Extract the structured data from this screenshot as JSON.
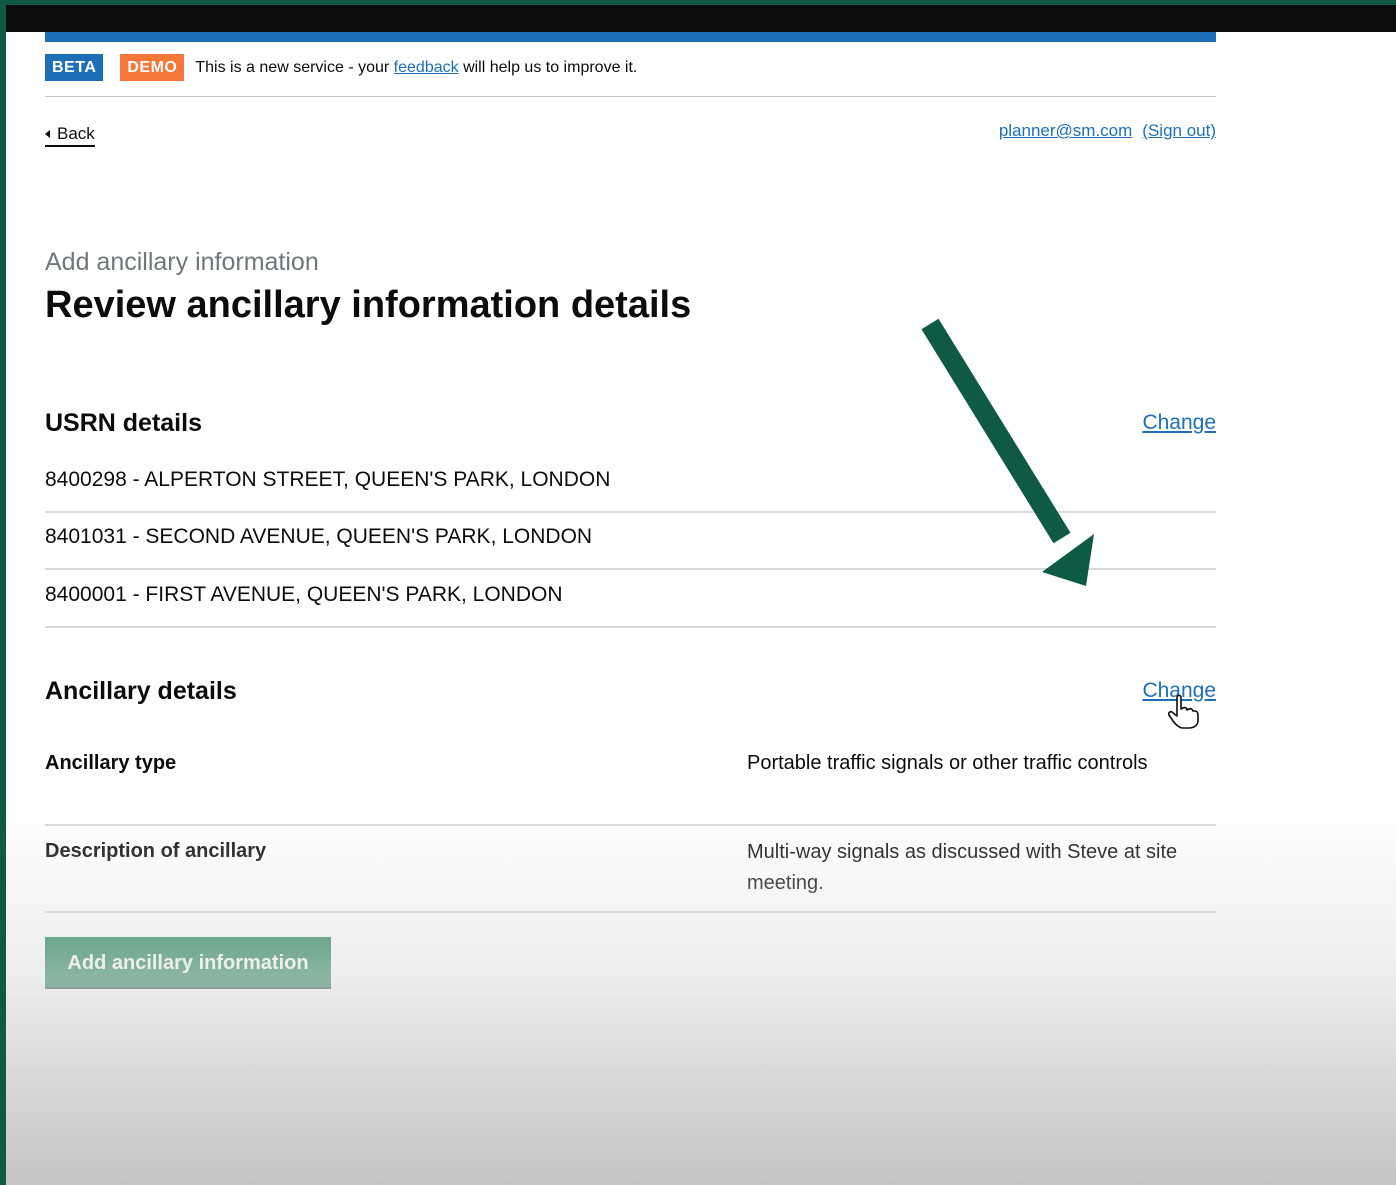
{
  "banner": {
    "beta_tag": "BETA",
    "demo_tag": "DEMO",
    "text_before": "This is a new service - your",
    "feedback_link": "feedback",
    "text_after": "will help us to improve it."
  },
  "nav": {
    "back_label": "Back",
    "user_email": "planner@sm.com",
    "sign_out": "(Sign out)"
  },
  "page": {
    "caption": "Add ancillary information",
    "title": "Review ancillary information details"
  },
  "usrn_section": {
    "heading": "USRN details",
    "change_label": "Change",
    "rows": [
      "8400298 - ALPERTON STREET, QUEEN'S PARK, LONDON",
      "8401031 - SECOND AVENUE, QUEEN'S PARK, LONDON",
      "8400001 - FIRST AVENUE, QUEEN'S PARK, LONDON"
    ]
  },
  "ancillary_section": {
    "heading": "Ancillary details",
    "change_label": "Change",
    "rows": [
      {
        "key": "Ancillary type",
        "value": "Portable traffic signals or other traffic controls"
      },
      {
        "key": "Description of ancillary",
        "value": "Multi-way signals as discussed with Steve at site meeting."
      }
    ]
  },
  "actions": {
    "submit_label": "Add ancillary information"
  },
  "colors": {
    "brand_blue": "#1d70b8",
    "beta_tag": "#1d70b8",
    "demo_tag": "#f47738",
    "button_green": "#00703c",
    "annotation_arrow": "#0f5a45"
  },
  "icons": {
    "back": "chevron-left-icon",
    "annotation": "arrow-down-right-icon",
    "pointer": "hand-pointer-icon"
  }
}
